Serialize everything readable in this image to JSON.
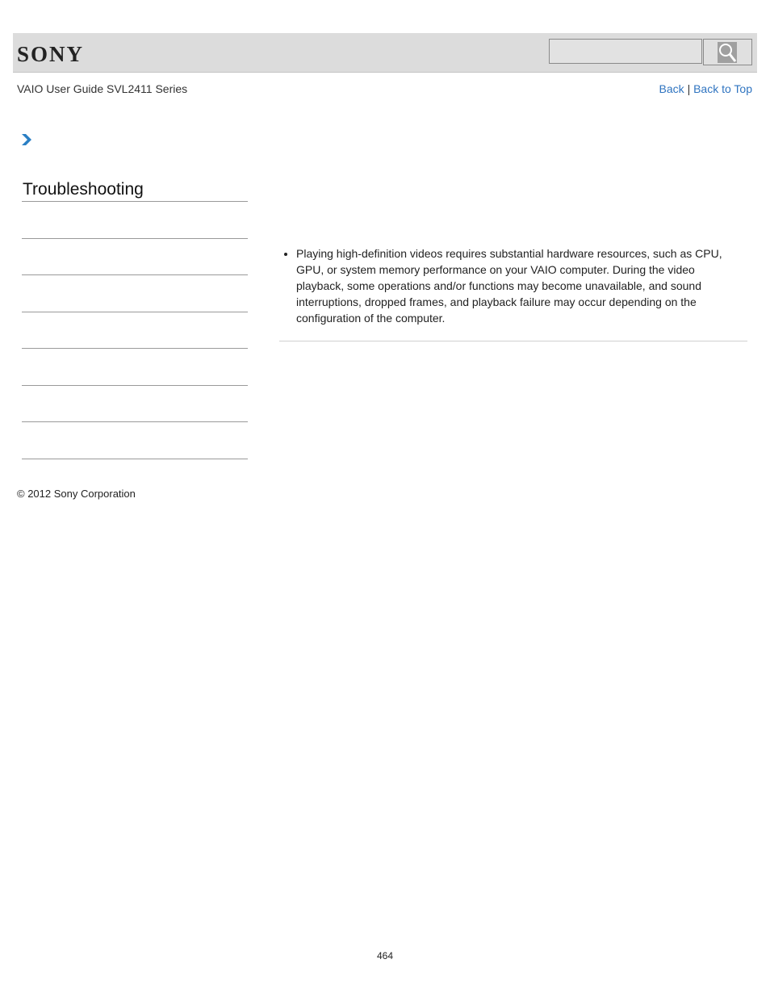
{
  "header": {
    "logo_text": "SONY",
    "search": {
      "placeholder": "",
      "value": ""
    },
    "search_icon": "search-icon"
  },
  "subheader": {
    "guide_title": "VAIO User Guide SVL2411 Series",
    "links": {
      "back": "Back",
      "separator": "|",
      "back_to_top": "Back to Top"
    }
  },
  "breadcrumb": {
    "icon": "chevron-right-icon"
  },
  "sidebar": {
    "section_title": "Troubleshooting",
    "items": [
      "",
      "",
      "",
      "",
      "",
      "",
      ""
    ]
  },
  "content": {
    "bullets": [
      "Playing high-definition videos requires substantial hardware resources, such as CPU, GPU, or system memory performance on your VAIO computer. During the video playback, some operations and/or functions may become unavailable, and sound interruptions, dropped frames, and playback failure may occur depending on the configuration of the computer."
    ]
  },
  "footer": {
    "copyright": "© 2012 Sony Corporation",
    "page_number": "464"
  },
  "colors": {
    "link": "#2f74c0",
    "header_bg": "#dcdcdc",
    "chevron": "#2a7fc4"
  }
}
